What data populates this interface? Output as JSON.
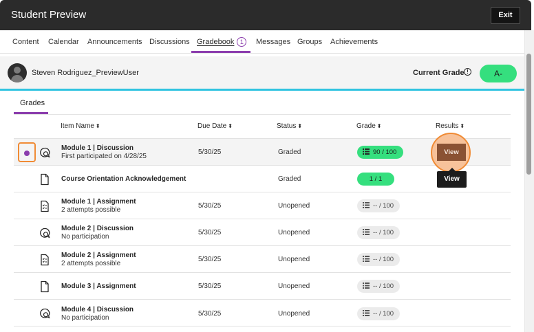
{
  "topbar": {
    "title": "Student Preview",
    "exit_label": "Exit"
  },
  "nav": {
    "tabs": [
      {
        "label": "Content"
      },
      {
        "label": "Calendar"
      },
      {
        "label": "Announcements"
      },
      {
        "label": "Discussions"
      },
      {
        "label": "Gradebook",
        "badge": "1"
      },
      {
        "label": "Messages"
      },
      {
        "label": "Groups"
      },
      {
        "label": "Achievements"
      }
    ],
    "active": "Gradebook"
  },
  "student": {
    "name": "Steven Rodriguez_PreviewUser",
    "current_grade_label": "Current Grade",
    "current_grade": "A-"
  },
  "subtabs": [
    {
      "label": "Grades"
    }
  ],
  "table": {
    "headers": {
      "item_name": "Item Name",
      "due_date": "Due Date",
      "status": "Status",
      "grade": "Grade",
      "results": "Results"
    },
    "rows": [
      {
        "icon": "discussion-icon",
        "name": "Module 1 | Discussion",
        "sub": "First participated on 4/28/25",
        "due": "5/30/25",
        "status": "Graded",
        "grade": "90 / 100",
        "grade_style": "green-with-icon",
        "action": "View",
        "highlighted": true,
        "new_indicator": true
      },
      {
        "icon": "document-icon",
        "name": "Course Orientation Acknowledgement",
        "sub": "",
        "due": "",
        "status": "Graded",
        "grade": "1 / 1",
        "grade_style": "green",
        "tooltip": "View"
      },
      {
        "icon": "assignment-icon",
        "name": "Module 1 | Assignment",
        "sub": "2 attempts possible",
        "due": "5/30/25",
        "status": "Unopened",
        "grade": "-- / 100",
        "grade_style": "grey"
      },
      {
        "icon": "discussion-icon",
        "name": "Module 2 | Discussion",
        "sub": "No participation",
        "due": "5/30/25",
        "status": "Unopened",
        "grade": "-- / 100",
        "grade_style": "grey"
      },
      {
        "icon": "assignment-icon",
        "name": "Module 2 | Assignment",
        "sub": "2 attempts possible",
        "due": "5/30/25",
        "status": "Unopened",
        "grade": "-- / 100",
        "grade_style": "grey"
      },
      {
        "icon": "document-icon",
        "name": "Module 3 | Assignment",
        "sub": "",
        "due": "5/30/25",
        "status": "Unopened",
        "grade": "-- / 100",
        "grade_style": "grey"
      },
      {
        "icon": "discussion-icon",
        "name": "Module 4 | Discussion",
        "sub": "No participation",
        "due": "5/30/25",
        "status": "Unopened",
        "grade": "-- / 100",
        "grade_style": "grey"
      }
    ]
  },
  "colors": {
    "accent_purple": "#8b3dad",
    "grade_green": "#35df7e",
    "cyan_rule": "#2fc3e0",
    "focus_orange": "#f08b35"
  }
}
